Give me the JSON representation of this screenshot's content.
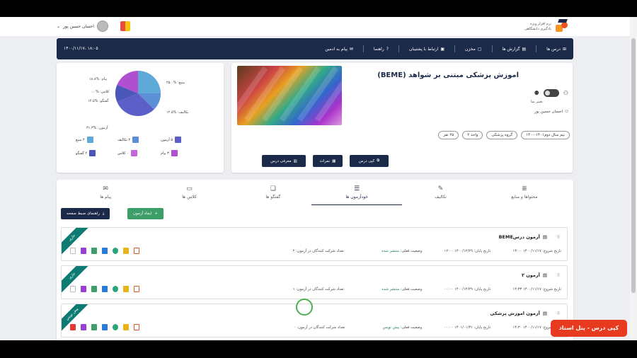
{
  "topbar": {
    "logo_text_line1": "نرم افزار ویژه",
    "logo_text_line2": "یادگیری دانشگاهی",
    "user_name": "احسان حسین پور",
    "user_chevron": "⌄"
  },
  "navbar": {
    "items": [
      {
        "label": "درس ها",
        "icon": "grid-icon"
      },
      {
        "label": "گزارش ها",
        "icon": "report-icon"
      },
      {
        "label": "مخزن",
        "icon": "file-icon"
      },
      {
        "label": "ارتباط با پشتیبان",
        "icon": "contact-icon"
      },
      {
        "label": "راهنما",
        "icon": "help-icon"
      },
      {
        "label": "پیام به ادمین",
        "icon": "message-icon"
      }
    ],
    "datetime": "۱۸:۰۵ ،۱۴۰۰/۱۱/۱۷"
  },
  "course": {
    "title": "اموزش پزشکی مبتنی بر شواهد (BEME)",
    "toggle_label": "تغییر نما",
    "teacher": "احسان حسین پور",
    "chips": [
      "نیم سال دوم۱۴۰۱-۱۴۰۰",
      "گروه پزشکی",
      "واحد ۲",
      "۲۵ نفر"
    ],
    "buttons": {
      "copy": "کپی درس",
      "grades": "نمرات",
      "intro": "معرفی درس"
    }
  },
  "stats": {
    "pie_labels": [
      "منبع: %۲۵.۰",
      "تکالیف: %۱۲.۵",
      "آزمون: %۳۱.۳",
      "گفتگو: %۱۲.۵",
      "کلاس: %۰.۰",
      "پیام: %۱۸.۸"
    ],
    "legend": [
      {
        "label": "۵ آزمون",
        "color": "#5b5fc7"
      },
      {
        "label": "۲ تکالیف",
        "color": "#5b8fd6"
      },
      {
        "label": "۴ منبع",
        "color": "#5fa9d9"
      },
      {
        "label": "۳ پیام",
        "color": "#b14fd1"
      },
      {
        "label": "۰ کلاس",
        "color": "#c466d9"
      },
      {
        "label": "۲ گفتگو",
        "color": "#4a56b8"
      }
    ]
  },
  "chart_data": {
    "type": "pie",
    "categories": [
      "منبع",
      "تکالیف",
      "آزمون",
      "گفتگو",
      "کلاس",
      "پیام"
    ],
    "values": [
      25.0,
      12.5,
      31.3,
      12.5,
      0.0,
      18.8
    ],
    "colors": [
      "#5fa9d9",
      "#5b8fd6",
      "#5b5fc7",
      "#4a56b8",
      "#c466d9",
      "#b14fd1"
    ]
  },
  "tabs": [
    {
      "label": "محتواها و منابع",
      "icon": "≣"
    },
    {
      "label": "تکالیف",
      "icon": "✎"
    },
    {
      "label": "خودآزمون ها",
      "icon": "☰"
    },
    {
      "label": "گفتگو ها",
      "icon": "❏"
    },
    {
      "label": "کلاس ها",
      "icon": "▭"
    },
    {
      "label": "پیام ها",
      "icon": "✉"
    }
  ],
  "actions": {
    "create_exam": "ایجاد آزمون",
    "recording_guide": "راهنمای ضبط صفحه"
  },
  "exams": [
    {
      "title": "آزمون درسBEME",
      "start": "تاریخ شروع: ۱۴۰۰/۱۱/۱۷ ۱۳:۰۰",
      "end": "تاریخ پایان: ۱۴۰۰/۱۲/۲۹ ۱۲:۰۰",
      "status_label": "وضعیت فعلی:",
      "status": "منتشر شده",
      "participants": "تعداد شرکت کنندگان در آزمون: ۲",
      "ribbon": "جاری"
    },
    {
      "title": "آزمون ۲",
      "start": "تاریخ شروع: ۱۴۰۰/۱۱/۱۷ ۱۴:۳۳",
      "end": "تاریخ پایان: ۱۴۰۰/۱۲/۲۹ ۰۰:۰۰",
      "status_label": "وضعیت فعلی:",
      "status": "منتشر شده",
      "participants": "تعداد شرکت کنندگان در آزمون: ۱",
      "ribbon": "جاری"
    },
    {
      "title": "آزمون اموزش پزشکی",
      "start": "تاریخ شروع: ۱۴۰۰/۱۱/۱۷ ۱۴:۳۰",
      "end": "تاریخ پایان: ۱۴۰۱/۰۱/۳۱ ۰۰:۰۰",
      "status_label": "وضعیت فعلی:",
      "status": "پیش نویس",
      "participants": "تعداد شرکت کنندگان در آزمون: ۰",
      "ribbon": "پیش نویس"
    }
  ],
  "banner": "کپی درس - پنل استاد"
}
